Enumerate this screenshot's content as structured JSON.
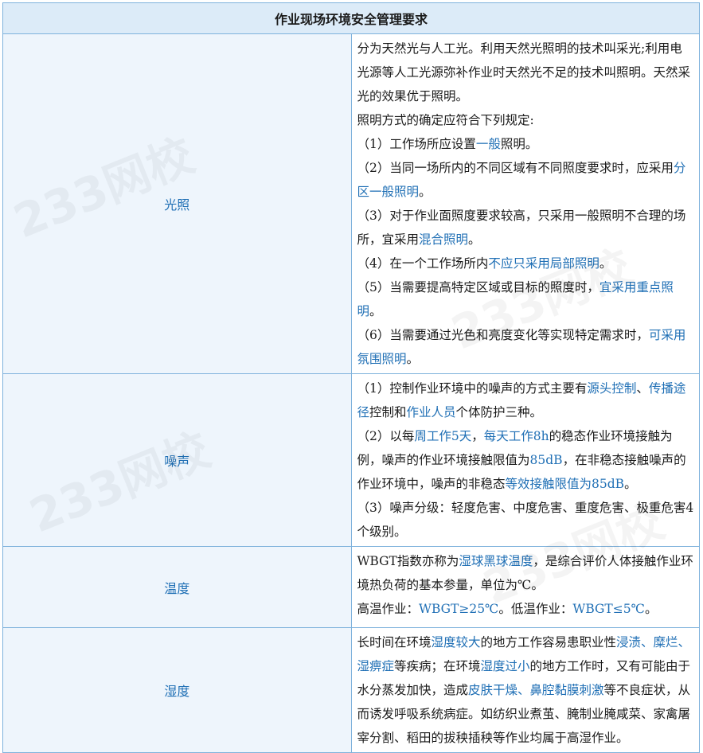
{
  "title": "作业现场环境安全管理要求",
  "watermark": "233网校",
  "rows": [
    {
      "category": "光照",
      "lines": [
        [
          {
            "t": "分为天然光与人工光。利用天然光照明的技术叫采光;利用电光源等人工光源弥补作业时天然光不足的技术叫照明。天然采光的效果优于照明。"
          }
        ],
        [
          {
            "t": "照明方式的确定应符合下列规定:"
          }
        ],
        [
          {
            "t": "（1）工作场所应设置"
          },
          {
            "t": "一般",
            "h": true
          },
          {
            "t": "照明。"
          }
        ],
        [
          {
            "t": "（2）当同一场所内的不同区域有不同照度要求时，应采用"
          },
          {
            "t": "分区一般照明",
            "h": true
          },
          {
            "t": "。"
          }
        ],
        [
          {
            "t": "（3）对于作业面照度要求较高，只采用一般照明不合理的场所，宜采用"
          },
          {
            "t": "混合照明",
            "h": true
          },
          {
            "t": "。"
          }
        ],
        [
          {
            "t": "（4）在一个工作场所内"
          },
          {
            "t": "不应只采用局部照明",
            "h": true
          },
          {
            "t": "。"
          }
        ],
        [
          {
            "t": "（5）当需要提高特定区域或目标的照度时，"
          },
          {
            "t": "宜采用重点照明",
            "h": true
          },
          {
            "t": "。"
          }
        ],
        [
          {
            "t": "（6）当需要通过光色和亮度变化等实现特定需求时，"
          },
          {
            "t": "可采用氛围照明",
            "h": true
          },
          {
            "t": "。"
          }
        ]
      ]
    },
    {
      "category": "噪声",
      "lines": [
        [
          {
            "t": "（1）控制作业环境中的噪声的方式主要有"
          },
          {
            "t": "源头控制",
            "h": true
          },
          {
            "t": "、"
          },
          {
            "t": "传播途径",
            "h": true
          },
          {
            "t": "控制和"
          },
          {
            "t": "作业人员",
            "h": true
          },
          {
            "t": "个体防护三种。"
          }
        ],
        [
          {
            "t": "（2）以每"
          },
          {
            "t": "周工作5天",
            "h": true
          },
          {
            "t": "，"
          },
          {
            "t": "每天工作8h",
            "h": true
          },
          {
            "t": "的稳态作业环境接触为例，噪声的作业环境接触限值为"
          },
          {
            "t": "85dB",
            "h": true
          },
          {
            "t": "，在非稳态接触噪声的作业环境中，噪声的非稳态"
          },
          {
            "t": "等效接触限值为85dB",
            "h": true
          },
          {
            "t": "。"
          }
        ],
        [
          {
            "t": "（3）噪声分级：轻度危害、中度危害、重度危害、极重危害4个级别。"
          }
        ]
      ]
    },
    {
      "category": "温度",
      "lines": [
        [
          {
            "t": "WBGT指数亦称为"
          },
          {
            "t": "湿球黑球温度",
            "h": true
          },
          {
            "t": "，是综合评价人体接触作业环境热负荷的基本参量，单位为℃。"
          }
        ],
        [
          {
            "t": "高温作业："
          },
          {
            "t": "WBGT≥25℃",
            "h": true
          },
          {
            "t": "。低温作业："
          },
          {
            "t": "WBGT≤5℃",
            "h": true
          },
          {
            "t": "。"
          }
        ]
      ]
    },
    {
      "category": "湿度",
      "lines": [
        [
          {
            "t": "长时间在环境"
          },
          {
            "t": "湿度较大",
            "h": true
          },
          {
            "t": "的地方工作容易患职业性"
          },
          {
            "t": "浸渍、糜烂、湿痹症",
            "h": true
          },
          {
            "t": "等疾病；在环境"
          },
          {
            "t": "湿度过小",
            "h": true
          },
          {
            "t": "的地方工作时，又有可能由于水分蒸发加快，造成"
          },
          {
            "t": "皮肤干燥、鼻腔黏膜刺激",
            "h": true
          },
          {
            "t": "等不良症状，从而诱发呼吸系统病症。如纺织业煮茧、腌制业腌咸菜、家禽屠宰分割、稻田的拔秧插秧等作业均属于高湿作业。"
          }
        ]
      ]
    }
  ]
}
